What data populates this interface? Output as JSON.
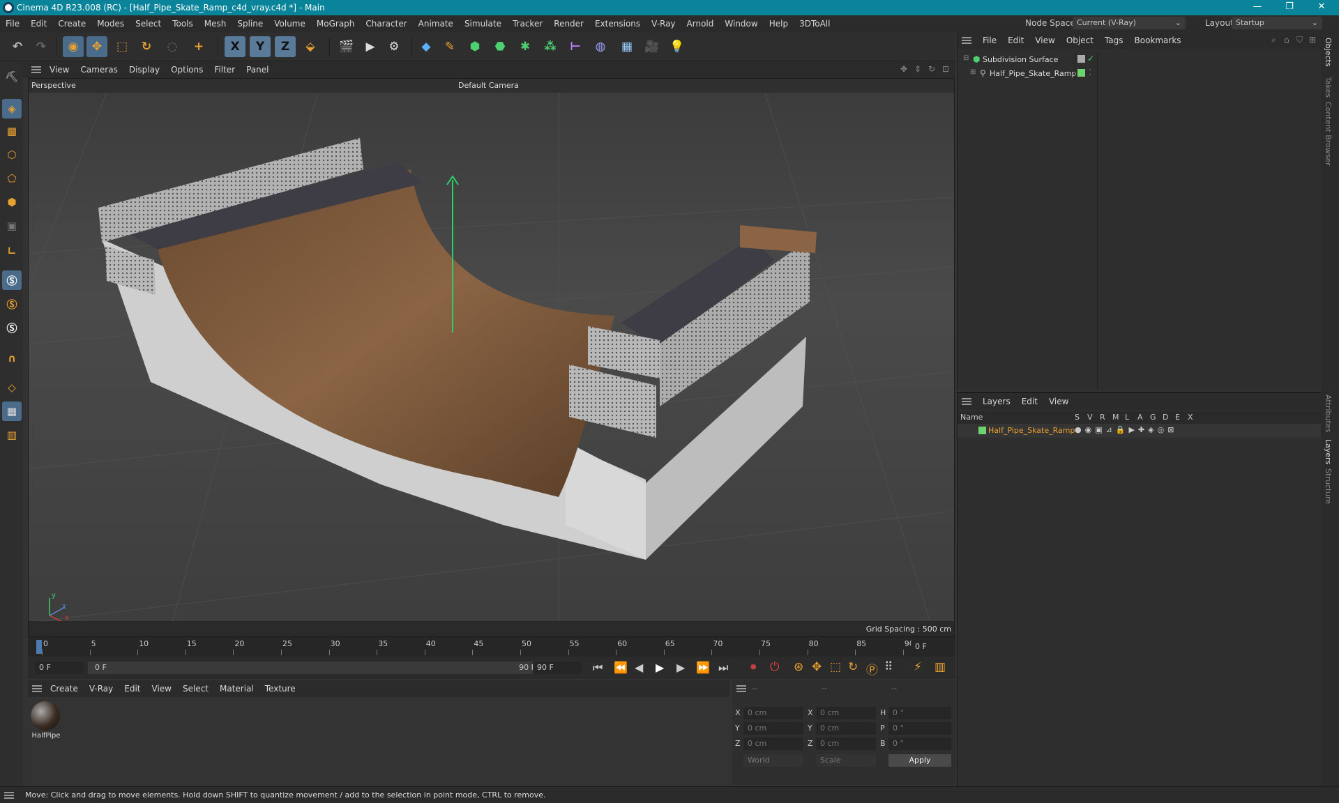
{
  "window": {
    "title": "Cinema 4D R23.008 (RC) - [Half_Pipe_Skate_Ramp_c4d_vray.c4d *] - Main",
    "min": "—",
    "max": "❐",
    "close": "✕"
  },
  "menu": [
    "File",
    "Edit",
    "Create",
    "Modes",
    "Select",
    "Tools",
    "Mesh",
    "Spline",
    "Volume",
    "MoGraph",
    "Character",
    "Animate",
    "Simulate",
    "Tracker",
    "Render",
    "Extensions",
    "V-Ray",
    "Arnold",
    "Window",
    "Help",
    "3DToAll"
  ],
  "node_space": {
    "label": "Node Space:",
    "value": "Current (V-Ray)"
  },
  "layout": {
    "label": "Layout:",
    "value": "Startup"
  },
  "toolbar_axes": [
    "X",
    "Y",
    "Z"
  ],
  "viewport": {
    "menu": [
      "View",
      "Cameras",
      "Display",
      "Options",
      "Filter",
      "Panel"
    ],
    "name": "Perspective",
    "camera": "Default Camera",
    "grid_spacing": "Grid Spacing : 500 cm",
    "axis": {
      "y": "y",
      "z": "z",
      "x": "x"
    }
  },
  "timeline": {
    "ticks": [
      "0",
      "5",
      "10",
      "15",
      "20",
      "25",
      "30",
      "35",
      "40",
      "45",
      "50",
      "55",
      "60",
      "65",
      "70",
      "75",
      "80",
      "85",
      "90"
    ],
    "end_field": "0 F"
  },
  "playbar": {
    "current": "0 F",
    "range_start": "0 F",
    "range_end": "90 F",
    "max": "90 F"
  },
  "materials": {
    "menu": [
      "Create",
      "V-Ray",
      "Edit",
      "View",
      "Select",
      "Material",
      "Texture"
    ],
    "items": [
      {
        "name": "HalfPipe"
      }
    ]
  },
  "coords": {
    "headers": [
      "--",
      "--",
      "--"
    ],
    "rows": [
      {
        "a": "X",
        "av": "0 cm",
        "b": "X",
        "bv": "0 cm",
        "c": "H",
        "cv": "0 °"
      },
      {
        "a": "Y",
        "av": "0 cm",
        "b": "Y",
        "bv": "0 cm",
        "c": "P",
        "cv": "0 °"
      },
      {
        "a": "Z",
        "av": "0 cm",
        "b": "Z",
        "bv": "0 cm",
        "c": "B",
        "cv": "0 °"
      }
    ],
    "mode": "World",
    "scale": "Scale",
    "apply": "Apply"
  },
  "objects": {
    "menu": [
      "File",
      "Edit",
      "View",
      "Object",
      "Tags",
      "Bookmarks"
    ],
    "tree": [
      {
        "name": "Subdivision Surface",
        "color": "#6ed26e"
      },
      {
        "name": "Half_Pipe_Skate_Ramp",
        "color": "#6ed26e"
      }
    ]
  },
  "layers": {
    "menu": [
      "Layers",
      "Edit",
      "View"
    ],
    "columns": [
      "Name",
      "S",
      "V",
      "R",
      "M",
      "L",
      "A",
      "G",
      "D",
      "E",
      "X"
    ],
    "rows": [
      {
        "name": "Half_Pipe_Skate_Ramp",
        "color": "#6ed26e"
      }
    ]
  },
  "side_tabs": [
    "Objects",
    "Takes",
    "Content Browser",
    "Attributes",
    "Layers",
    "Structure"
  ],
  "status": "Move: Click and drag to move elements. Hold down SHIFT to quantize movement / add to the selection in point mode, CTRL to remove."
}
